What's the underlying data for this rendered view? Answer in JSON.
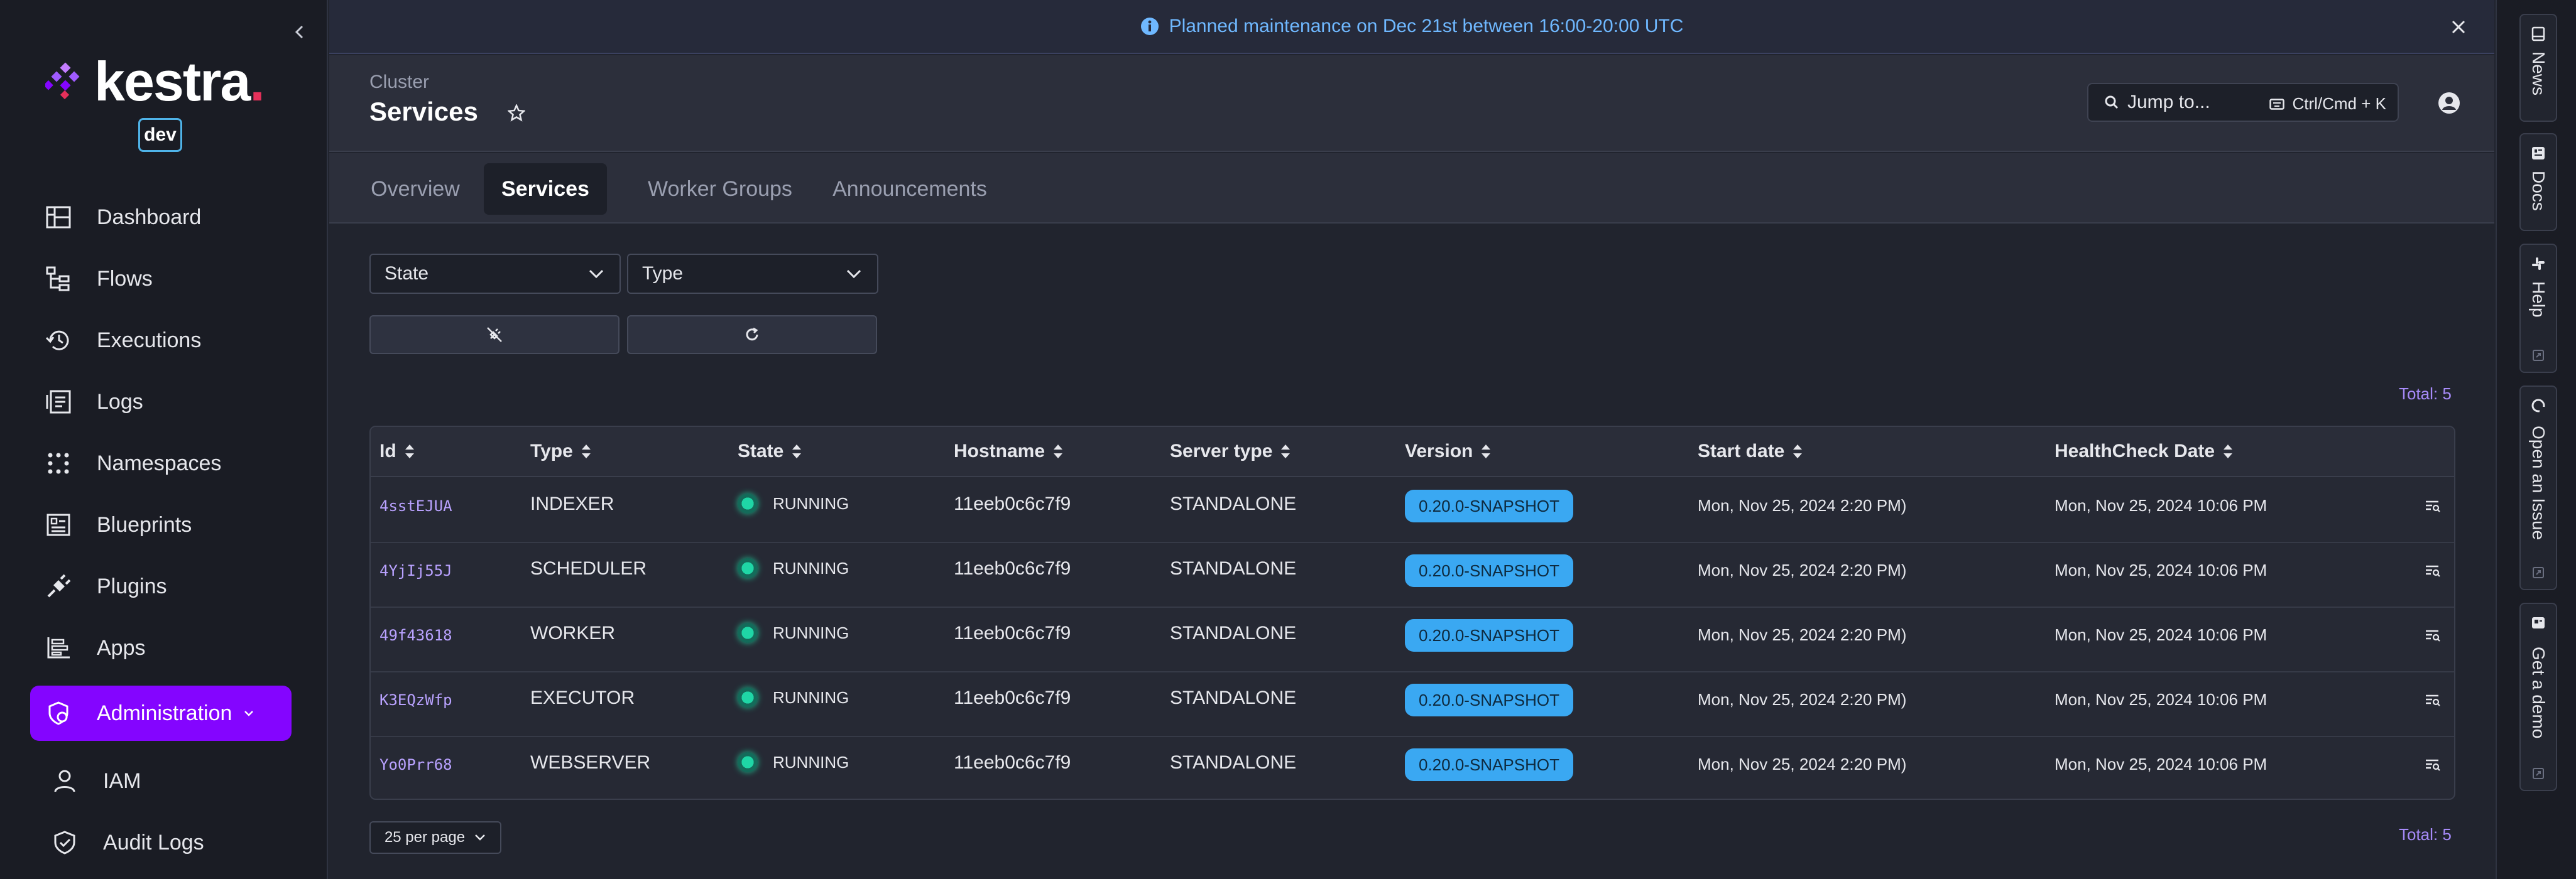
{
  "sidebar": {
    "logo_text": "kestra",
    "logo_dot": ".",
    "env_badge": "dev",
    "items": [
      {
        "label": "Dashboard",
        "icon": "dashboard-icon"
      },
      {
        "label": "Flows",
        "icon": "flows-icon"
      },
      {
        "label": "Executions",
        "icon": "executions-icon"
      },
      {
        "label": "Logs",
        "icon": "logs-icon"
      },
      {
        "label": "Namespaces",
        "icon": "namespaces-icon"
      },
      {
        "label": "Blueprints",
        "icon": "blueprints-icon"
      },
      {
        "label": "Plugins",
        "icon": "plugins-icon"
      },
      {
        "label": "Apps",
        "icon": "apps-icon"
      },
      {
        "label": "Administration",
        "icon": "administration-icon",
        "active": true
      }
    ],
    "sub_items": [
      {
        "label": "IAM",
        "icon": "user-icon"
      },
      {
        "label": "Audit Logs",
        "icon": "shield-icon"
      }
    ]
  },
  "banner": {
    "text": "Planned maintenance on Dec 21st between 16:00-20:00 UTC"
  },
  "header": {
    "breadcrumb": "Cluster",
    "title": "Services",
    "search_placeholder": "Jump to...",
    "search_shortcut": "Ctrl/Cmd + K"
  },
  "tabs": [
    {
      "label": "Overview"
    },
    {
      "label": "Services",
      "active": true
    },
    {
      "label": "Worker Groups"
    },
    {
      "label": "Announcements"
    }
  ],
  "filters": {
    "state_label": "State",
    "type_label": "Type"
  },
  "table": {
    "total_top": "Total: 5",
    "total_bottom": "Total: 5",
    "columns": [
      "Id",
      "Type",
      "State",
      "Hostname",
      "Server type",
      "Version",
      "Start date",
      "HealthCheck Date"
    ],
    "rows": [
      {
        "id": "4sstEJUA",
        "type": "INDEXER",
        "state": "RUNNING",
        "hostname": "11eeb0c6c7f9",
        "server_type": "STANDALONE",
        "version": "0.20.0-SNAPSHOT",
        "start_date": "Mon, Nov 25, 2024 2:20 PM)",
        "health_date": "Mon, Nov 25, 2024 10:06 PM"
      },
      {
        "id": "4YjIj55J",
        "type": "SCHEDULER",
        "state": "RUNNING",
        "hostname": "11eeb0c6c7f9",
        "server_type": "STANDALONE",
        "version": "0.20.0-SNAPSHOT",
        "start_date": "Mon, Nov 25, 2024 2:20 PM)",
        "health_date": "Mon, Nov 25, 2024 10:06 PM"
      },
      {
        "id": "49f43618",
        "type": "WORKER",
        "state": "RUNNING",
        "hostname": "11eeb0c6c7f9",
        "server_type": "STANDALONE",
        "version": "0.20.0-SNAPSHOT",
        "start_date": "Mon, Nov 25, 2024 2:20 PM)",
        "health_date": "Mon, Nov 25, 2024 10:06 PM"
      },
      {
        "id": "K3EQzWfp",
        "type": "EXECUTOR",
        "state": "RUNNING",
        "hostname": "11eeb0c6c7f9",
        "server_type": "STANDALONE",
        "version": "0.20.0-SNAPSHOT",
        "start_date": "Mon, Nov 25, 2024 2:20 PM)",
        "health_date": "Mon, Nov 25, 2024 10:06 PM"
      },
      {
        "id": "Yo0Prr68",
        "type": "WEBSERVER",
        "state": "RUNNING",
        "hostname": "11eeb0c6c7f9",
        "server_type": "STANDALONE",
        "version": "0.20.0-SNAPSHOT",
        "start_date": "Mon, Nov 25, 2024 2:20 PM)",
        "health_date": "Mon, Nov 25, 2024 10:06 PM"
      }
    ],
    "per_page": "25 per page"
  },
  "right_rail": [
    {
      "label": "News",
      "icon": "news-icon"
    },
    {
      "label": "Docs",
      "icon": "docs-icon"
    },
    {
      "label": "Help",
      "icon": "slack-icon"
    },
    {
      "label": "Open an Issue",
      "icon": "github-icon"
    },
    {
      "label": "Get a demo",
      "icon": "demo-icon"
    }
  ],
  "colors": {
    "accent": "#8405ff",
    "banner_text": "#6fb8ff",
    "version_badge": "#3aa8f2",
    "running_dot": "#1fd6a6",
    "total_text": "#a78bfa"
  }
}
